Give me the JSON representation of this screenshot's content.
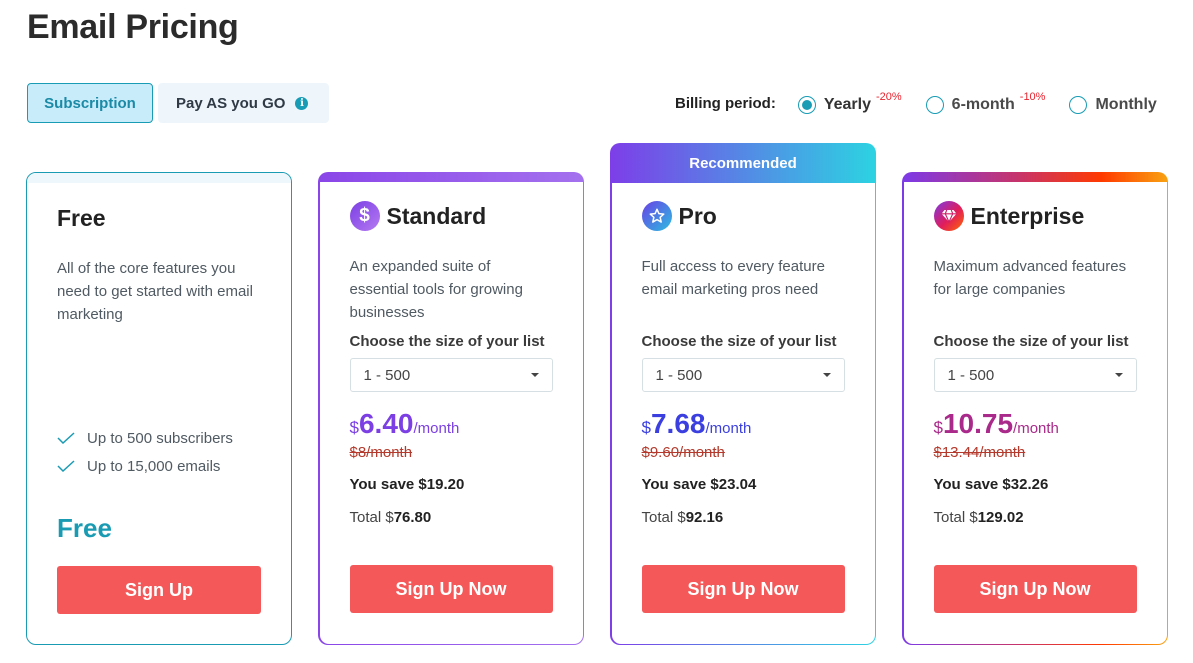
{
  "page": {
    "title": "Email Pricing"
  },
  "tabs": [
    {
      "label": "Subscription",
      "active": true
    },
    {
      "label": "Pay AS you GO",
      "icon": "info-icon",
      "active": false
    }
  ],
  "billing": {
    "label": "Billing period:",
    "options": [
      {
        "label": "Yearly",
        "discount": "-20%",
        "selected": true
      },
      {
        "label": "6-month",
        "discount": "-10%",
        "selected": false
      },
      {
        "label": "Monthly",
        "discount": "",
        "selected": false
      }
    ]
  },
  "plans": {
    "free": {
      "name": "Free",
      "description": "All of the core features you need to get started with email marketing",
      "features": [
        "Up to 500 subscribers",
        "Up to 15,000 emails"
      ],
      "price": "Free",
      "button": "Sign Up"
    },
    "standard": {
      "name": "Standard",
      "icon": "dollar-icon",
      "description": "An expanded suite of essential tools for growing businesses",
      "list_label": "Choose the size of your list",
      "list_size": "1 - 500",
      "currency": "$",
      "price": "6.40",
      "per": "/month",
      "old_price": "$8/month",
      "save": "You save $19.20",
      "total_label": "Total $",
      "total": "76.80",
      "button": "Sign Up Now",
      "color": "#7b3fe4"
    },
    "pro": {
      "badge": "Recommended",
      "name": "Pro",
      "icon": "star-icon",
      "description": "Full access to every feature email marketing pros need",
      "list_label": "Choose the size of your list",
      "list_size": "1 - 500",
      "currency": "$",
      "price": "7.68",
      "per": "/month",
      "old_price": "$9.60/month",
      "save": "You save $23.04",
      "total_label": "Total $",
      "total": "92.16",
      "button": "Sign Up Now",
      "color": "#3b3fe0"
    },
    "enterprise": {
      "name": "Enterprise",
      "icon": "diamond-icon",
      "description": "Maximum advanced features for large companies",
      "list_label": "Choose the size of your list",
      "list_size": "1 - 500",
      "currency": "$",
      "price": "10.75",
      "per": "/month",
      "old_price": "$13.44/month",
      "save": "You save $32.26",
      "total_label": "Total $",
      "total": "129.02",
      "button": "Sign Up Now",
      "color": "#a92a8a"
    }
  }
}
